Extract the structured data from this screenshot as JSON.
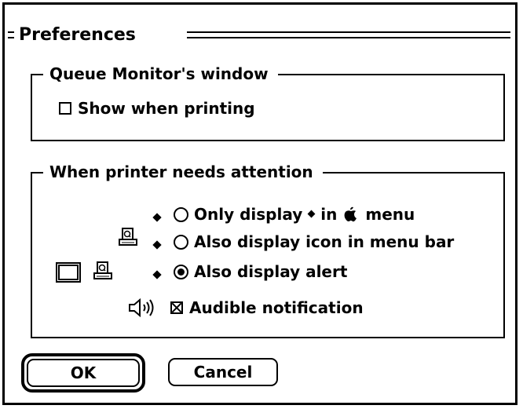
{
  "dialog": {
    "title": "Preferences"
  },
  "queue_group": {
    "title": "Queue Monitor's window",
    "show_when_printing": {
      "label": "Show when printing",
      "checked": false
    }
  },
  "attention_group": {
    "title": "When printer needs attention",
    "options": [
      {
        "label_before": "Only display",
        "label_after": "in",
        "label_end": "menu",
        "selected": false
      },
      {
        "label": "Also display icon in menu bar",
        "selected": false
      },
      {
        "label": "Also display alert",
        "selected": true
      }
    ],
    "audible": {
      "label": "Audible notification",
      "checked": true
    }
  },
  "buttons": {
    "ok": "OK",
    "cancel": "Cancel"
  },
  "icons": [
    "diamond-icon",
    "apple-icon",
    "printer-icon",
    "alert-window-icon",
    "speaker-icon"
  ]
}
